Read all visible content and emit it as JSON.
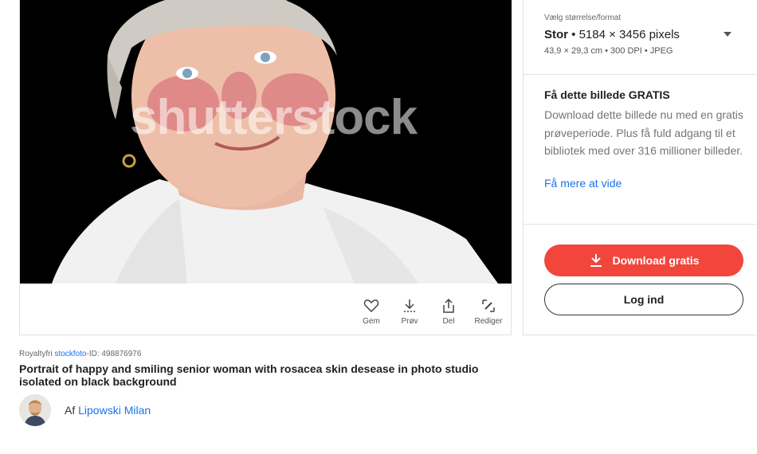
{
  "image": {
    "watermark": "shutterstock"
  },
  "toolbar": {
    "save_label": "Gem",
    "try_label": "Prøv",
    "share_label": "Del",
    "edit_label": "Rediger"
  },
  "meta": {
    "royalty_prefix": "Royaltyfri ",
    "royalty_link": "stockfoto",
    "id_text": "-ID: 498876976"
  },
  "title": "Portrait of happy and smiling senior woman with rosacea skin desease in photo studio isolated on black background",
  "author": {
    "prefix": "Af ",
    "name": "Lipowski Milan"
  },
  "size": {
    "label": "Vælg størrelse/format",
    "name": "Stor",
    "pixels": " • 5184 × 3456 pixels",
    "details": "43,9 × 29,3 cm • 300 DPI • JPEG"
  },
  "free": {
    "title": "Få dette billede GRATIS",
    "description": "Download dette billede nu med en gratis prøveperiode. Plus få fuld adgang til et bibliotek med over 316 millioner billeder.",
    "learn_more": "Få mere at vide"
  },
  "buttons": {
    "download": "Download gratis",
    "login": "Log ind"
  },
  "colors": {
    "accent": "#f2463d",
    "link": "#1a73e8"
  }
}
